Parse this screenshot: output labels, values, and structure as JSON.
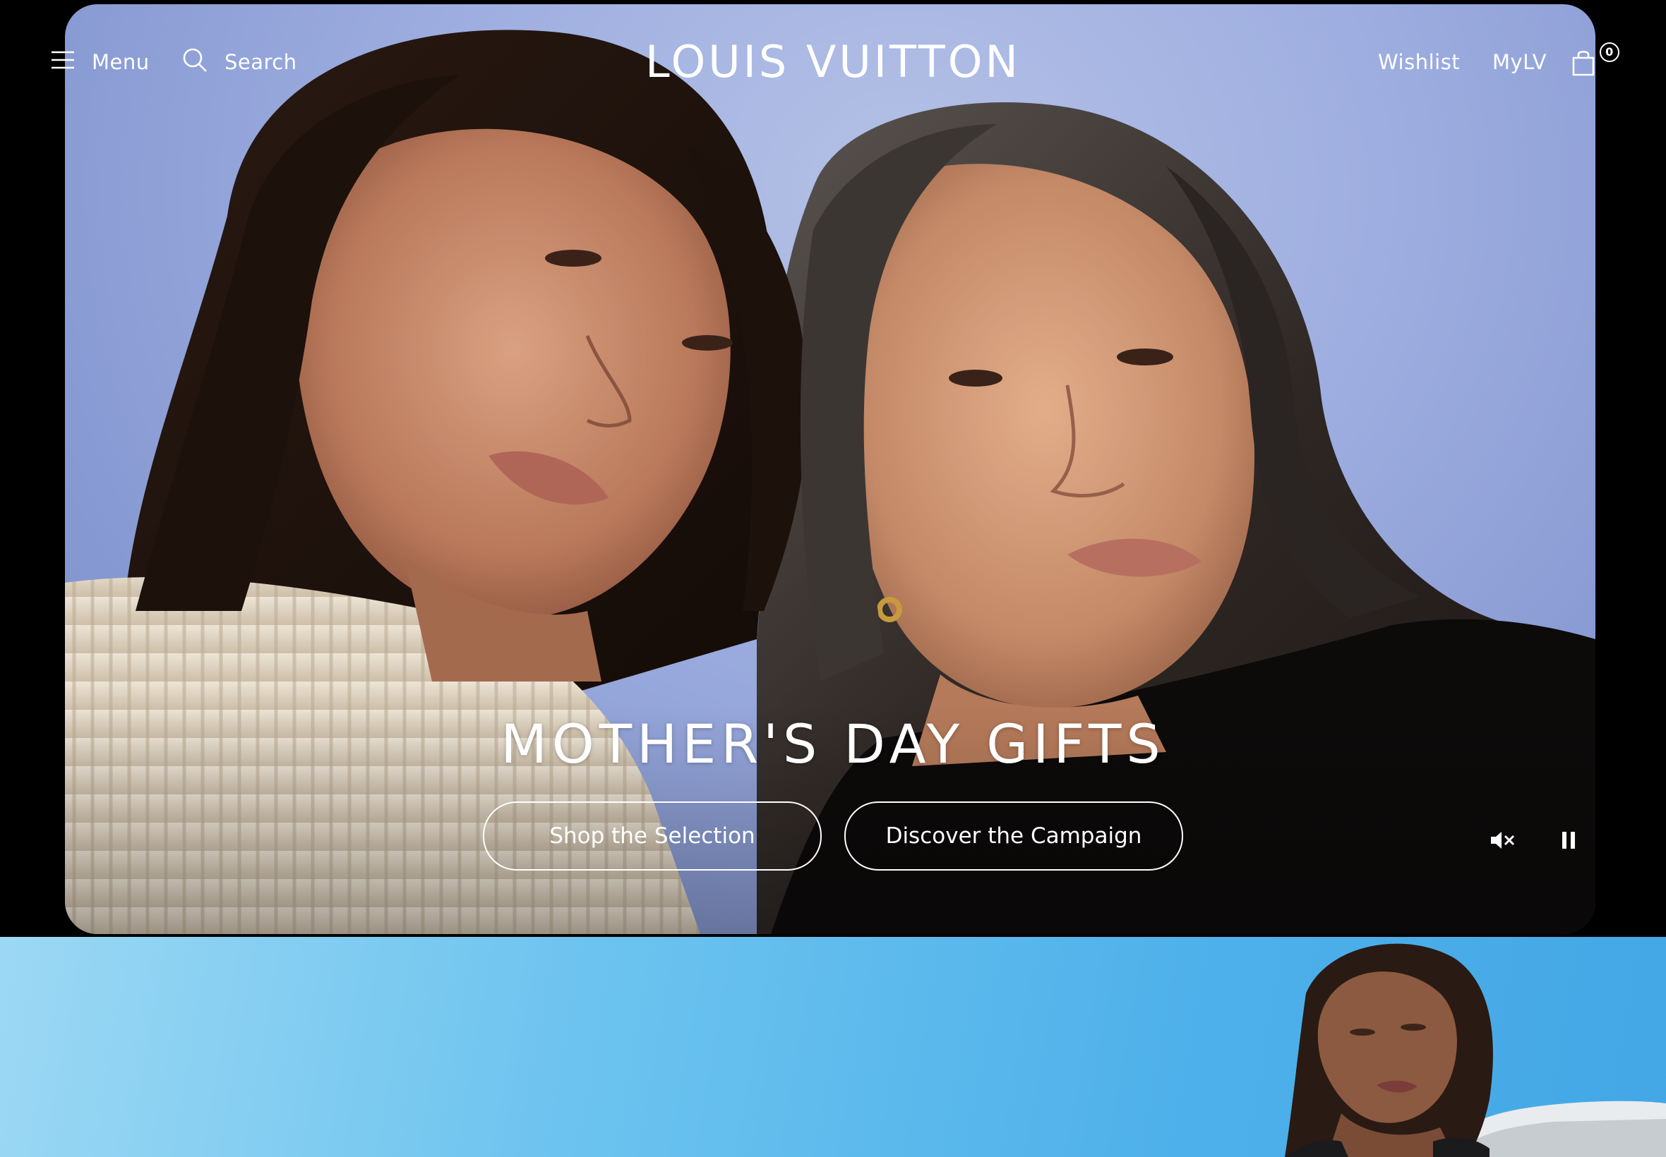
{
  "header": {
    "menu_label": "Menu",
    "search_label": "Search",
    "brand": "LOUIS VUITTON",
    "wishlist_label": "Wishlist",
    "mylv_label": "MyLV",
    "bag_count": "0"
  },
  "hero": {
    "title": "MOTHER'S DAY GIFTS",
    "cta_primary": "Shop the Selection",
    "cta_secondary": "Discover the Campaign",
    "media_controls": {
      "mute_icon": "speaker-muted-icon",
      "pause_icon": "pause-icon"
    }
  },
  "colors": {
    "hero_backdrop": "#9eaee0",
    "text": "#ffffff",
    "section2_sky": "#4fb1ea"
  }
}
